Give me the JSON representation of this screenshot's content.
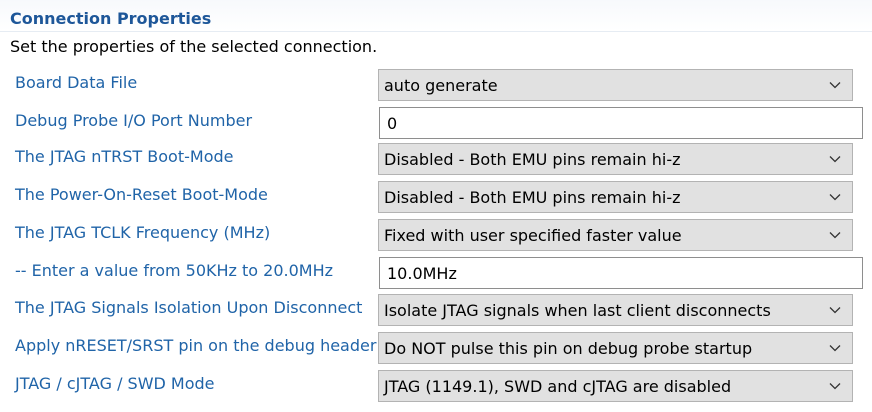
{
  "header": {
    "title": "Connection Properties"
  },
  "description": "Set the properties of the selected connection.",
  "rows": [
    {
      "label": "Board Data File",
      "type": "select",
      "value": "auto generate"
    },
    {
      "label": "Debug Probe I/O Port Number",
      "type": "text",
      "value": "0"
    },
    {
      "label": "The JTAG nTRST Boot-Mode",
      "type": "select",
      "value": "Disabled - Both EMU pins remain hi-z"
    },
    {
      "label": "The Power-On-Reset Boot-Mode",
      "type": "select",
      "value": "Disabled - Both EMU pins remain hi-z"
    },
    {
      "label": "The JTAG TCLK Frequency (MHz)",
      "type": "select",
      "value": "Fixed with user specified faster value"
    },
    {
      "label": "-- Enter a value from 50KHz to 20.0MHz",
      "type": "text",
      "value": "10.0MHz"
    },
    {
      "label": "The JTAG Signals Isolation Upon Disconnect",
      "type": "select",
      "value": "Isolate JTAG signals when last client disconnects"
    },
    {
      "label": "Apply nRESET/SRST pin on the debug header",
      "type": "select",
      "value": "Do NOT pulse this pin on debug probe startup"
    },
    {
      "label": "JTAG / cJTAG / SWD Mode",
      "type": "select",
      "value": "JTAG (1149.1), SWD and cJTAG are disabled"
    }
  ],
  "icons": {
    "dropdown": "chevron-down-icon"
  },
  "colors": {
    "title": "#1e5799",
    "label": "#2064a8",
    "select_bg": "#e1e1e1"
  }
}
